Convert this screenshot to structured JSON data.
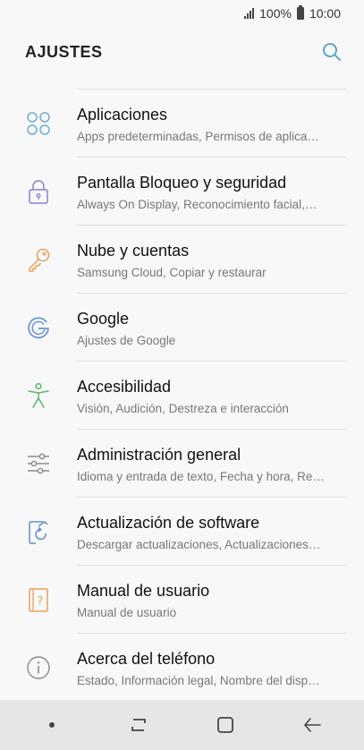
{
  "status_bar": {
    "battery_percent": "100%",
    "time": "10:00"
  },
  "header": {
    "title": "AJUSTES",
    "search_icon": "search-icon"
  },
  "settings_items": [
    {
      "icon": "apps-grid-icon",
      "color": "#6aaed6",
      "label": "Aplicaciones",
      "sub": "Apps predeterminadas, Permisos de aplica…"
    },
    {
      "icon": "lock-icon",
      "color": "#8c7fd0",
      "label": "Pantalla Bloqueo y seguridad",
      "sub": "Always On Display, Reconocimiento facial,…"
    },
    {
      "icon": "key-icon",
      "color": "#e8a05a",
      "label": "Nube y cuentas",
      "sub": "Samsung Cloud, Copiar y restaurar"
    },
    {
      "icon": "google-icon",
      "color": "#5f8fcf",
      "label": "Google",
      "sub": "Ajustes de Google"
    },
    {
      "icon": "accessibility-icon",
      "color": "#5db36a",
      "label": "Accesibilidad",
      "sub": "Visión, Audición, Destreza e interacción"
    },
    {
      "icon": "sliders-icon",
      "color": "#8a8a8a",
      "label": "Administración general",
      "sub": "Idioma y entrada de texto, Fecha y hora, Re…"
    },
    {
      "icon": "software-update-icon",
      "color": "#5f8fcf",
      "label": "Actualización de software",
      "sub": "Descargar actualizaciones, Actualizaciones…"
    },
    {
      "icon": "user-manual-icon",
      "color": "#e8a05a",
      "label": "Manual de usuario",
      "sub": "Manual de usuario"
    },
    {
      "icon": "info-icon",
      "color": "#8a8a8a",
      "label": "Acerca del teléfono",
      "sub": "Estado, Información legal, Nombre del disp…"
    }
  ],
  "nav_bar": {
    "dot_icon": "nav-dot-icon",
    "recents_icon": "recents-icon",
    "home_icon": "home-icon",
    "back_icon": "back-icon"
  },
  "colors": {
    "accent": "#4a9fc4",
    "background": "#f8f8f8",
    "navbar": "#e6e6e6"
  }
}
